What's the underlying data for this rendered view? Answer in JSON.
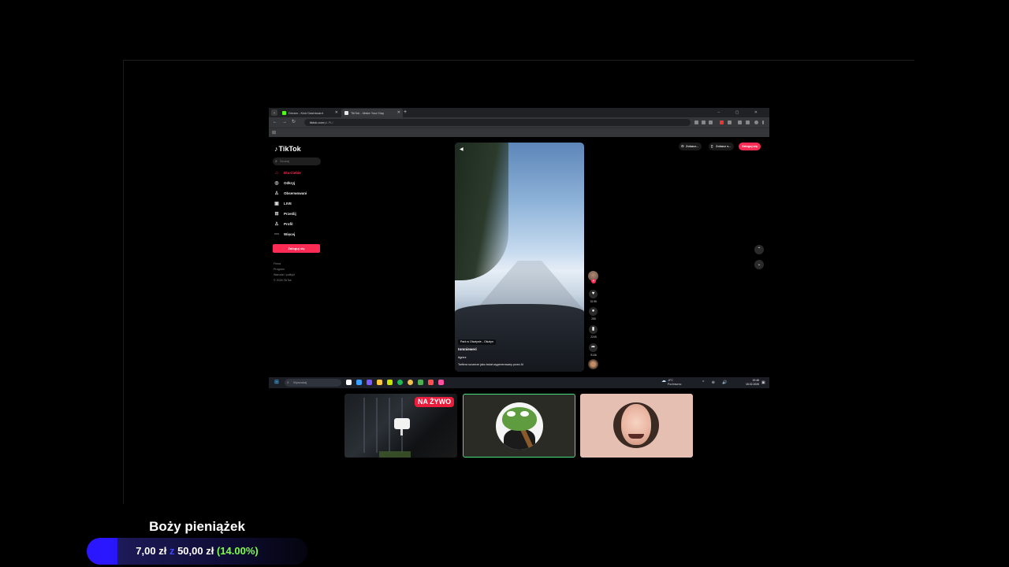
{
  "browser": {
    "tabs": [
      {
        "label": "Dream - Kick Dashboard",
        "color": "#53fc18"
      },
      {
        "label": "TikTok - Make Your Day",
        "color": "#e8e8e8"
      }
    ],
    "new_tab": "+",
    "window_controls": "– ▢ ✕",
    "url": "tiktok.com",
    "url_path": "/pl-PL/"
  },
  "tiktok": {
    "logo": "TikTok",
    "search_placeholder": "Szukaj",
    "nav": [
      {
        "label": "Dla Ciebie",
        "icon": "home-icon",
        "active": true
      },
      {
        "label": "Odkryj",
        "icon": "compass-icon"
      },
      {
        "label": "Obserwowani",
        "icon": "following-icon"
      },
      {
        "label": "LIVE",
        "icon": "live-icon"
      },
      {
        "label": "Prześlij",
        "icon": "upload-icon"
      },
      {
        "label": "Profil",
        "icon": "profile-icon"
      },
      {
        "label": "Więcej",
        "icon": "more-icon"
      }
    ],
    "login_button": "Zaloguj się",
    "footer": [
      "Firma",
      "Program",
      "Warunki i polityki",
      "© 2026 TikTok"
    ],
    "top_buttons": [
      "Zobacz...",
      "Zobacz s...",
      "Zaloguj się"
    ],
    "video": {
      "location": "Park w Olsztynie - Olsztyn",
      "username": "tomnieweri",
      "hashtag": "#grrrz",
      "description": "Tarfiera szczerze jako świat wygenerowany przez AI",
      "counts": {
        "likes": "32.9K",
        "comments": "255",
        "saves": "2249",
        "shares": "9136"
      }
    }
  },
  "taskbar": {
    "search_placeholder": "Wyszukaj",
    "weather_temp": "-6°C",
    "weather_desc": "Pochmurno",
    "tray": "^ ⊕ 🔊",
    "time": "19:46",
    "date": "18.02.2026",
    "apps_colors": [
      "#ffffff",
      "#3aa0ff",
      "#7b5cff",
      "#ffc83d",
      "#c6e400",
      "#1db954",
      "#f2c14e",
      "#4caf50",
      "#ff5050",
      "#ff4fa0"
    ]
  },
  "overlay": {
    "live_badge": "NA ŻYWO"
  },
  "goal": {
    "title": "Boży pieniążek",
    "current": "7,00 zł",
    "sep": "z",
    "target": "50,00 zł",
    "percent_text": "(14.00%)",
    "progress": 0.14,
    "accent": "#2a17ff"
  }
}
